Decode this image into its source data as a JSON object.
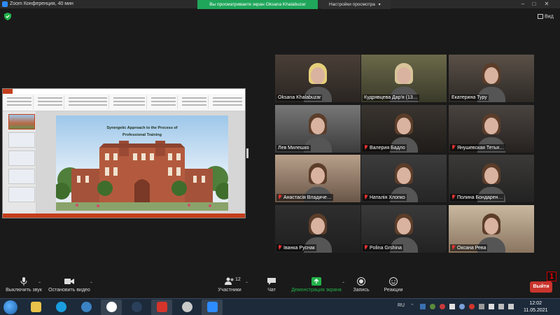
{
  "window": {
    "title": "Zoom Конференция, 40 мин",
    "share_banner": "Вы просматриваете экран Oksana Khalabuzar",
    "view_options": "Настройки просмотра",
    "view_button": "Вид"
  },
  "shared_screen": {
    "slide_title_line1": "Synergetic Approach to the Process of",
    "slide_title_line2": "Professional Training"
  },
  "participants": [
    {
      "name": "Oksana Khalabuzar",
      "muted": false
    },
    {
      "name": "Кудрявцева Дар'я (13…",
      "muted": false,
      "active": true
    },
    {
      "name": "Екатерина Туру",
      "muted": false
    },
    {
      "name": "Лев Милешко",
      "muted": false
    },
    {
      "name": "Валерия Бадло",
      "muted": true
    },
    {
      "name": "Янушевская Тетья…",
      "muted": true
    },
    {
      "name": "Анастасія Владиче…",
      "muted": true
    },
    {
      "name": "Наталія Хлопко",
      "muted": true
    },
    {
      "name": "Полина Бондарен…",
      "muted": true
    },
    {
      "name": "Іванка Руснак",
      "muted": true
    },
    {
      "name": "Polina Grshina",
      "muted": true
    },
    {
      "name": "Оксана Рева",
      "muted": true
    }
  ],
  "toolbar": {
    "mute": "Выключить звук",
    "stop_video": "Остановить видео",
    "participants": "Участники",
    "participants_count": "12",
    "chat": "Чат",
    "share_screen": "Демонстрация экрана",
    "record": "Запись",
    "reactions": "Реакции",
    "leave": "Выйти",
    "badge": "1"
  },
  "taskbar": {
    "lang": "RU",
    "time": "12:02",
    "date": "11.05.2021"
  },
  "colors": {
    "share_green": "#1fa65a",
    "active_speaker": "#e8e05a",
    "leave_red": "#c8352d"
  }
}
